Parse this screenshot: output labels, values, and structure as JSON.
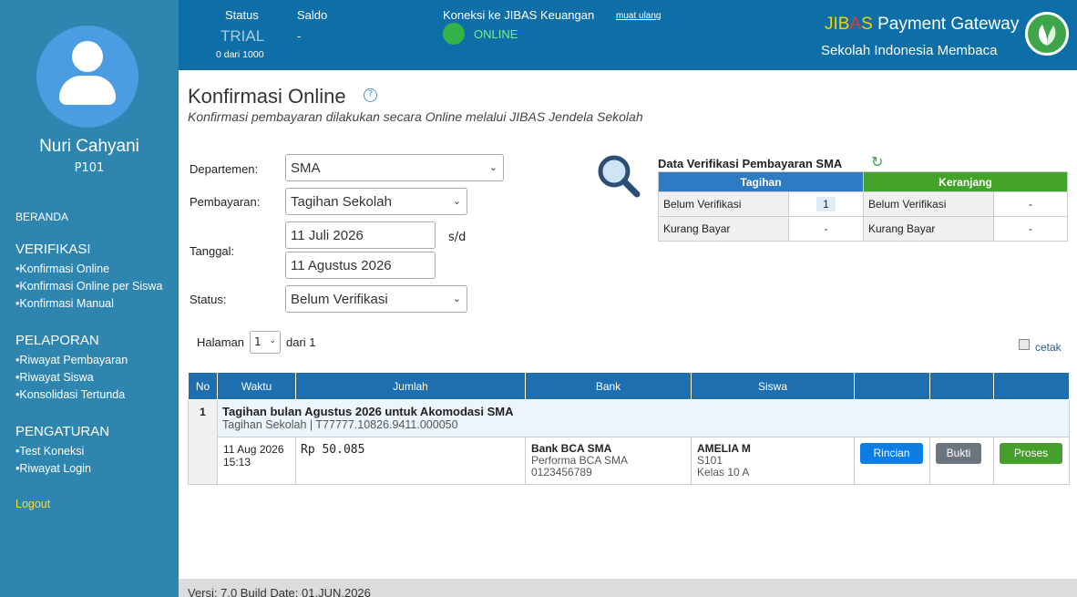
{
  "sidebar": {
    "user_name": "Nuri Cahyani",
    "user_id": "P101",
    "beranda": "BERANDA",
    "sections": [
      {
        "title": "VERIFIKASI",
        "items": [
          "Konfirmasi Online",
          "Konfirmasi Online per Siswa",
          "Konfirmasi Manual"
        ]
      },
      {
        "title": "PELAPORAN",
        "items": [
          "Riwayat Pembayaran",
          "Riwayat Siswa",
          "Konsolidasi Tertunda"
        ]
      },
      {
        "title": "PENGATURAN",
        "items": [
          "Test Koneksi",
          "Riwayat Login"
        ]
      }
    ],
    "logout": "Logout"
  },
  "header": {
    "status_label": "Status",
    "status_value": "TRIAL",
    "status_sub": "0 dari 1000",
    "saldo_label": "Saldo",
    "saldo_value": "-",
    "conn_label": "Koneksi ke JIBAS Keuangan",
    "conn_retry": "muat ulang",
    "conn_state": "ONLINE",
    "gw_ji": "JIB",
    "gw_a": "A",
    "gw_s": "S",
    "gw_rest": " Payment Gateway",
    "school": "Sekolah Indonesia Membaca"
  },
  "page": {
    "title": "Konfirmasi Online",
    "subtitle": "Konfirmasi pembayaran dilakukan secara Online melalui JIBAS Jendela Sekolah"
  },
  "form": {
    "departemen_label": "Departemen:",
    "departemen_value": "SMA",
    "pembayaran_label": "Pembayaran:",
    "pembayaran_value": "Tagihan Sekolah",
    "tanggal_label": "Tanggal:",
    "tanggal_from": "11 Juli 2026",
    "tanggal_sep": "s/d",
    "tanggal_to": "11 Agustus 2026",
    "status_label": "Status:",
    "status_value": "Belum Verifikasi"
  },
  "verif": {
    "title": "Data Verifikasi Pembayaran SMA",
    "col_tagihan": "Tagihan",
    "col_keranjang": "Keranjang",
    "rows": [
      {
        "label_a": "Belum Verifikasi",
        "value_a": "1",
        "label_b": "Belum Verifikasi",
        "value_b": "-"
      },
      {
        "label_a": "Kurang Bayar",
        "value_a": "-",
        "label_b": "Kurang Bayar",
        "value_b": "-"
      }
    ]
  },
  "paging": {
    "label": "Halaman",
    "page": "1",
    "of": "dari 1",
    "print": "cetak"
  },
  "table": {
    "headers": [
      "No",
      "Waktu",
      "Jumlah",
      "Bank",
      "Siswa",
      "",
      "",
      ""
    ],
    "group": {
      "no": "1",
      "title": "Tagihan bulan Agustus 2026 untuk Akomodasi SMA",
      "sub": "Tagihan Sekolah | T77777.10826.9411.000050"
    },
    "row": {
      "date": "11 Aug 2026",
      "time": "15:13",
      "amount": "Rp 50.085",
      "bank_name": "Bank BCA SMA",
      "bank_acc_name": "Performa BCA SMA",
      "bank_acc_no": "0123456789",
      "student_name": "AMELIA M",
      "student_id": "S101",
      "student_class": "Kelas 10 A",
      "btn_rincian": "Rincian",
      "btn_bukti": "Bukti",
      "btn_proses": "Proses"
    }
  },
  "footer": {
    "version": "Versi: 7.0 Build Date: 01.JUN.2026"
  }
}
